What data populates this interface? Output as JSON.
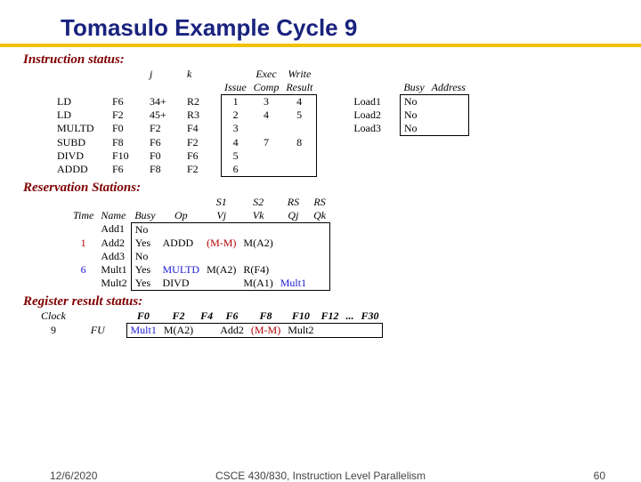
{
  "title": "Tomasulo Example Cycle 9",
  "sections": {
    "is": "Instruction status:",
    "rs": "Reservation Stations:",
    "rr": "Register result status:"
  },
  "is_hdr": {
    "j": "j",
    "k": "k",
    "issue": "Issue",
    "exec": "Exec",
    "write": "Write",
    "comp": "Comp",
    "result": "Result",
    "busy": "Busy",
    "addr": "Address"
  },
  "is_rows": [
    {
      "op": "LD",
      "fi": "F6",
      "j": "34+",
      "k": "R2",
      "issue": "1",
      "comp": "3",
      "result": "4",
      "unit": "Load1",
      "busy": "No",
      "addr": ""
    },
    {
      "op": "LD",
      "fi": "F2",
      "j": "45+",
      "k": "R3",
      "issue": "2",
      "comp": "4",
      "result": "5",
      "unit": "Load2",
      "busy": "No",
      "addr": ""
    },
    {
      "op": "MULTD",
      "fi": "F0",
      "j": "F2",
      "k": "F4",
      "issue": "3",
      "comp": "",
      "result": "",
      "unit": "Load3",
      "busy": "No",
      "addr": ""
    },
    {
      "op": "SUBD",
      "fi": "F8",
      "j": "F6",
      "k": "F2",
      "issue": "4",
      "comp": "7",
      "result": "8",
      "unit": "",
      "busy": "",
      "addr": ""
    },
    {
      "op": "DIVD",
      "fi": "F10",
      "j": "F0",
      "k": "F6",
      "issue": "5",
      "comp": "",
      "result": "",
      "unit": "",
      "busy": "",
      "addr": ""
    },
    {
      "op": "ADDD",
      "fi": "F6",
      "j": "F8",
      "k": "F2",
      "issue": "6",
      "comp": "",
      "result": "",
      "unit": "",
      "busy": "",
      "addr": ""
    }
  ],
  "rs_hdr": {
    "time": "Time",
    "name": "Name",
    "busy": "Busy",
    "op": "Op",
    "vj": "Vj",
    "vk": "Vk",
    "qj": "Qj",
    "qk": "Qk",
    "s1": "S1",
    "s2": "S2",
    "rs1": "RS",
    "rs2": "RS"
  },
  "rs_rows": [
    {
      "time": "",
      "name": "Add1",
      "busy": "No",
      "op": "",
      "vj": "",
      "vk": "",
      "qj": "",
      "qk": ""
    },
    {
      "time": "1",
      "name": "Add2",
      "busy": "Yes",
      "op": "ADDD",
      "vj": "(M-M)",
      "vk": "M(A2)",
      "qj": "",
      "qk": ""
    },
    {
      "time": "",
      "name": "Add3",
      "busy": "No",
      "op": "",
      "vj": "",
      "vk": "",
      "qj": "",
      "qk": ""
    },
    {
      "time": "6",
      "name": "Mult1",
      "busy": "Yes",
      "op": "MULTD",
      "vj": "M(A2)",
      "vk": "R(F4)",
      "qj": "",
      "qk": ""
    },
    {
      "time": "",
      "name": "Mult2",
      "busy": "Yes",
      "op": "DIVD",
      "vj": "",
      "vk": "M(A1)",
      "qj": "Mult1",
      "qk": ""
    }
  ],
  "rr_hdr": {
    "clock": "Clock",
    "fu": "FU",
    "f0": "F0",
    "f2": "F2",
    "f4": "F4",
    "f6": "F6",
    "f8": "F8",
    "f10": "F10",
    "f12": "F12",
    "dots": "...",
    "f30": "F30"
  },
  "rr_row": {
    "clock": "9",
    "f0": "Mult1",
    "f2": "M(A2)",
    "f4": "",
    "f6": "Add2",
    "f8": "(M-M)",
    "f10": "Mult2",
    "f12": "",
    "f30": ""
  },
  "footer": {
    "date": "12/6/2020",
    "mid": "CSCE 430/830, Instruction Level Parallelism",
    "num": "60"
  }
}
